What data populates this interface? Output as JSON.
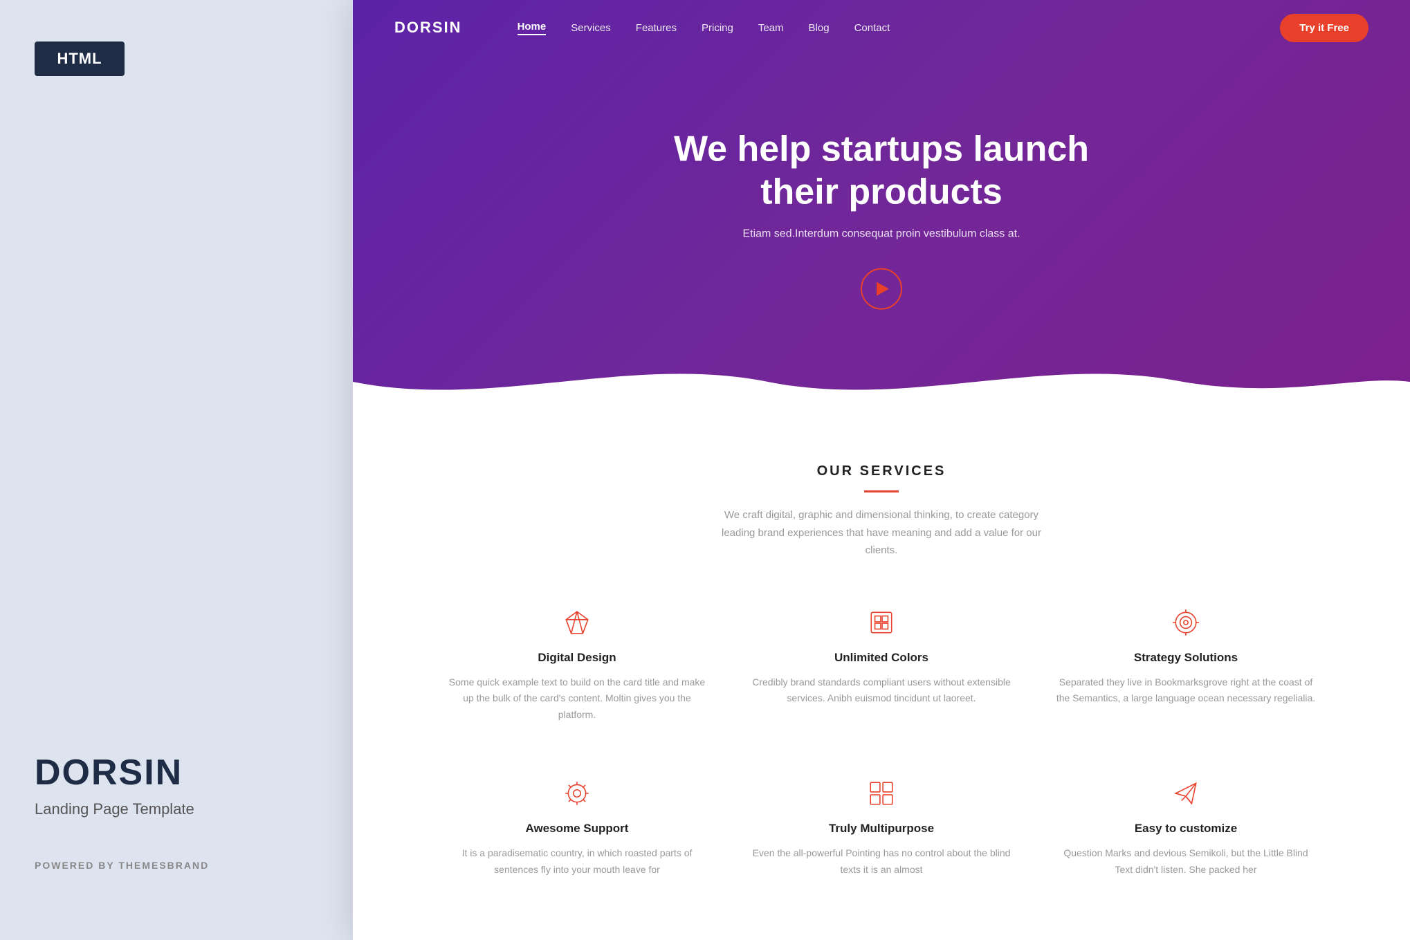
{
  "left": {
    "badge": "HTML",
    "brand": "DORSIN",
    "subtitle": "Landing Page Template",
    "powered": "POWERED BY THEMESBRAND"
  },
  "navbar": {
    "logo": "DORSIN",
    "links": [
      {
        "label": "Home",
        "active": true
      },
      {
        "label": "Services",
        "active": false
      },
      {
        "label": "Features",
        "active": false
      },
      {
        "label": "Pricing",
        "active": false
      },
      {
        "label": "Team",
        "active": false
      },
      {
        "label": "Blog",
        "active": false
      },
      {
        "label": "Contact",
        "active": false
      }
    ],
    "cta": "Try it Free"
  },
  "hero": {
    "title": "We help startups launch their products",
    "subtitle": "Etiam sed.Interdum consequat proin vestibulum class at."
  },
  "services": {
    "label": "OUR SERVICES",
    "description": "We craft digital, graphic and dimensional thinking, to create category leading brand experiences that have meaning and add a value for our clients.",
    "items": [
      {
        "title": "Digital Design",
        "text": "Some quick example text to build on the card title and make up the bulk of the card's content. Moltin gives you the platform.",
        "icon": "diamond"
      },
      {
        "title": "Unlimited Colors",
        "text": "Credibly brand standards compliant users without extensible services. Anibh euismod tincidunt ut laoreet.",
        "icon": "palette"
      },
      {
        "title": "Strategy Solutions",
        "text": "Separated they live in Bookmarksgrove right at the coast of the Semantics, a large language ocean necessary regelialia.",
        "icon": "target"
      },
      {
        "title": "Awesome Support",
        "text": "It is a paradisematic country, in which roasted parts of sentences fly into your mouth leave for",
        "icon": "settings"
      },
      {
        "title": "Truly Multipurpose",
        "text": "Even the all-powerful Pointing has no control about the blind texts it is an almost",
        "icon": "grid"
      },
      {
        "title": "Easy to customize",
        "text": "Question Marks and devious Semikoli, but the Little Blind Text didn't listen. She packed her",
        "icon": "plane"
      }
    ]
  }
}
